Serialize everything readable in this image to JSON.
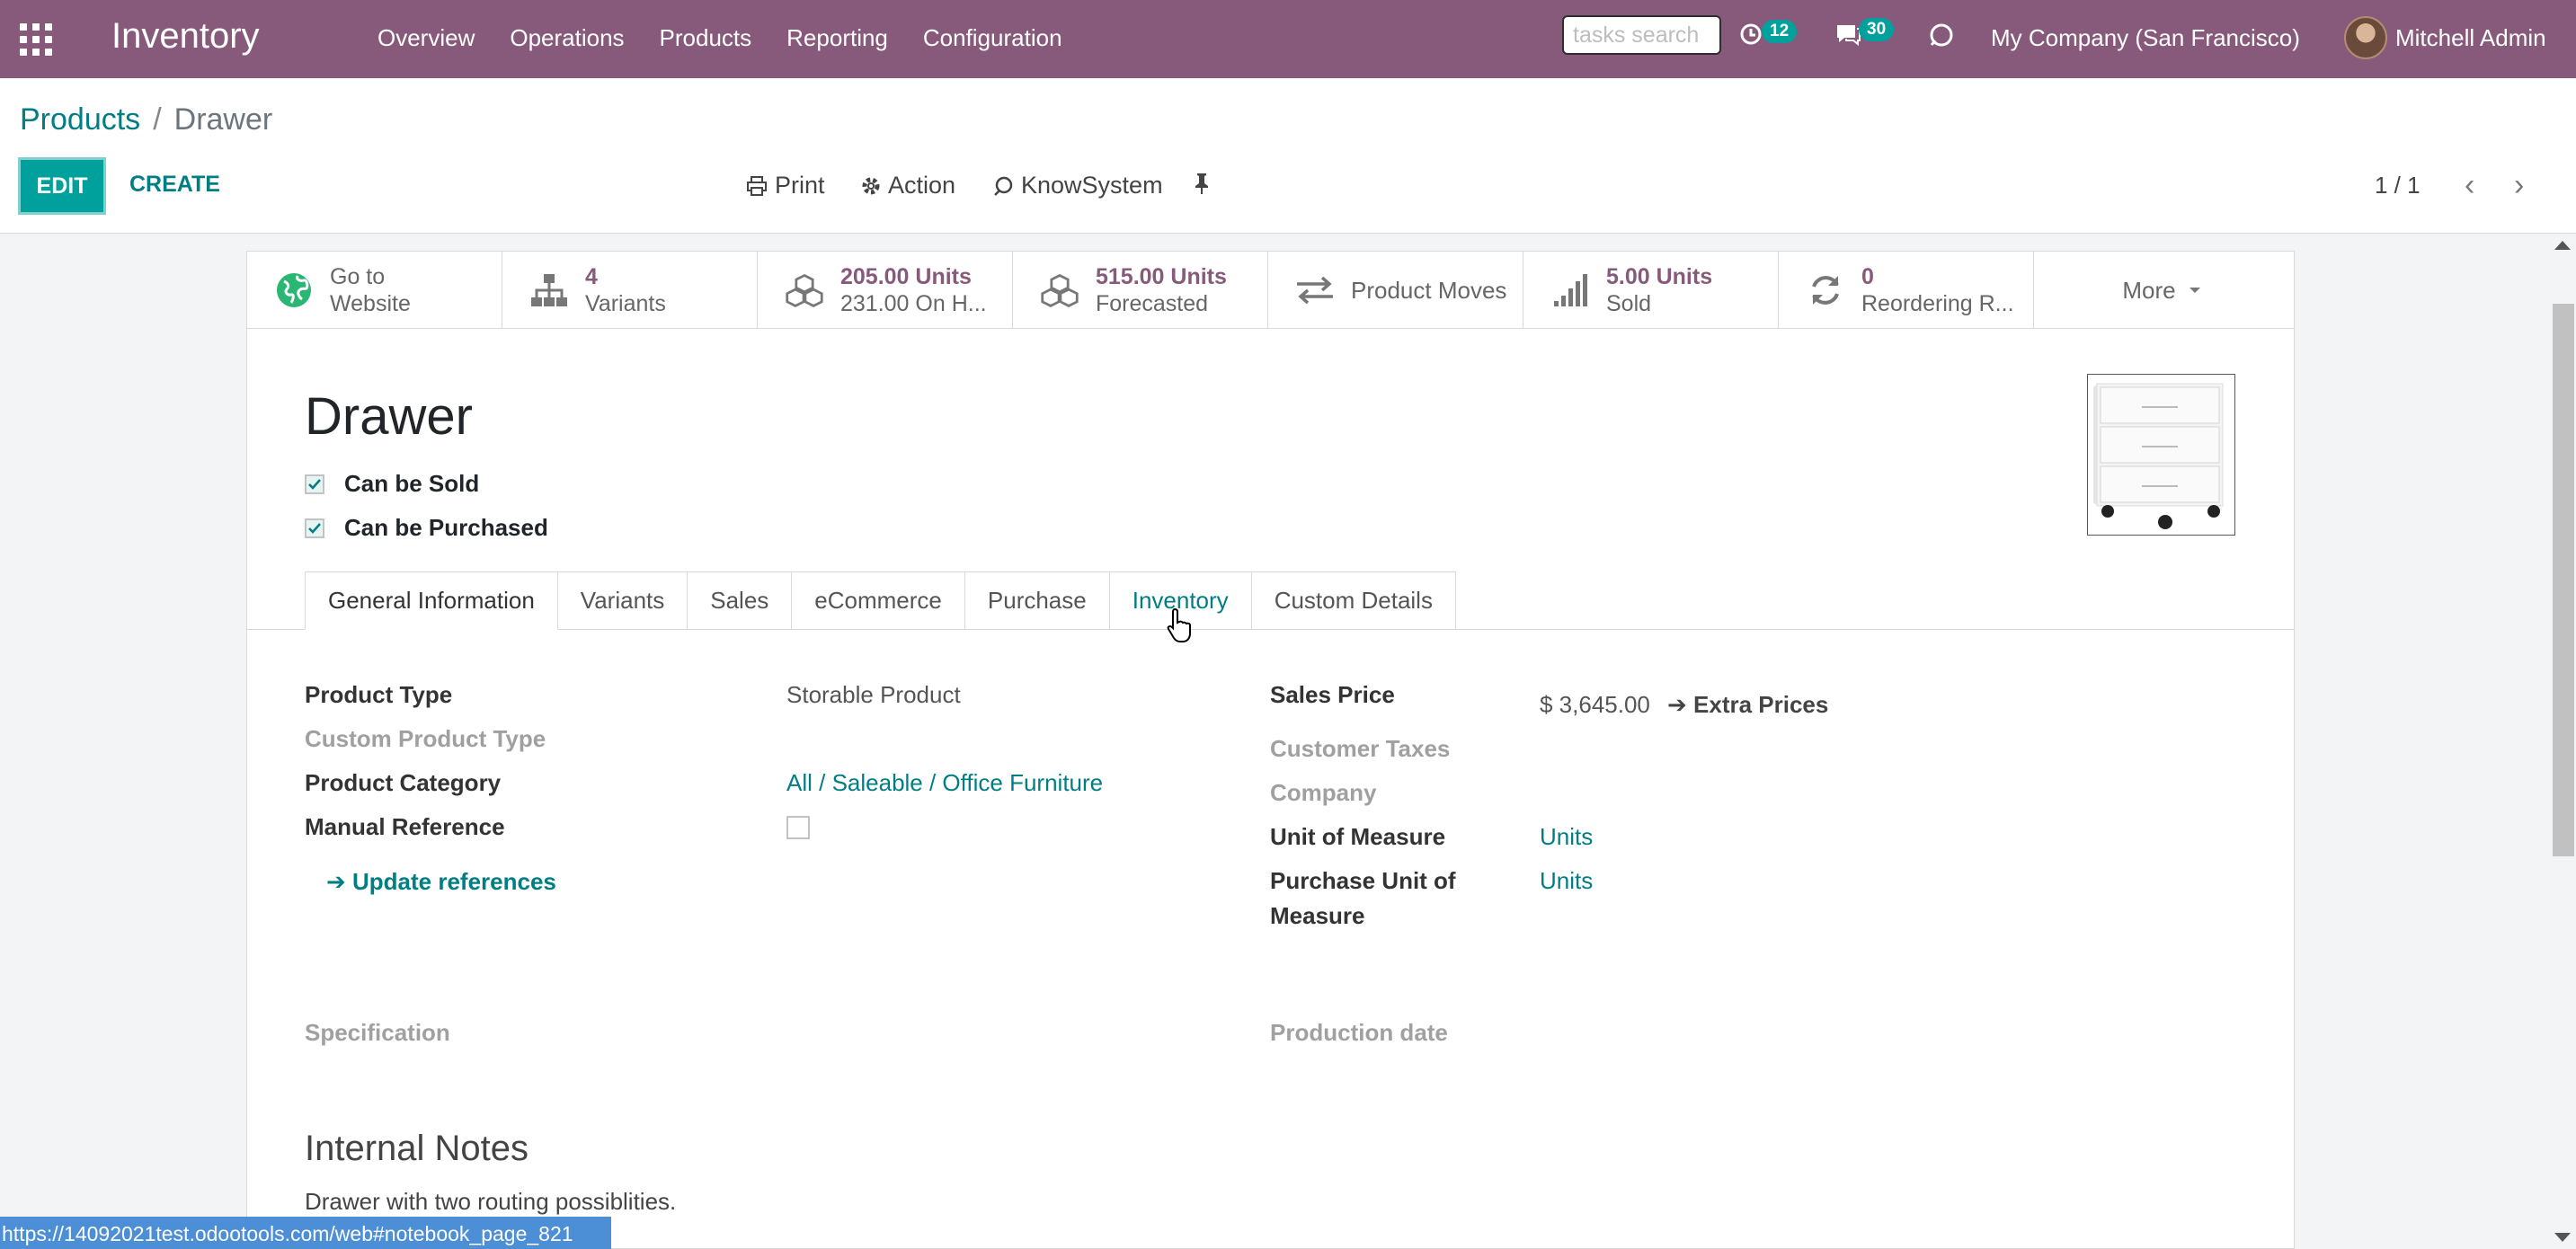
{
  "navbar": {
    "app_title": "Inventory",
    "menu": [
      "Overview",
      "Operations",
      "Products",
      "Reporting",
      "Configuration"
    ],
    "search_placeholder": "tasks search",
    "activity_count": "12",
    "messages_count": "30",
    "company": "My Company (San Francisco)",
    "user": "Mitchell Admin"
  },
  "breadcrumb": {
    "parent": "Products",
    "current": "Drawer"
  },
  "toolbar": {
    "edit": "EDIT",
    "create": "CREATE",
    "print": "Print",
    "action": "Action",
    "knowsystem": "KnowSystem",
    "pager": "1 / 1"
  },
  "smart_buttons": [
    {
      "icon": "globe-icon",
      "value": "Go to",
      "label": "Website"
    },
    {
      "icon": "sitemap-icon",
      "value": "4",
      "label": "Variants"
    },
    {
      "icon": "cubes-icon",
      "value": "205.00 Units",
      "label": "231.00 On H..."
    },
    {
      "icon": "cubes-icon",
      "value": "515.00 Units",
      "label": "Forecasted"
    },
    {
      "icon": "exchange-icon",
      "label": "Product Moves"
    },
    {
      "icon": "signal-icon",
      "value": "5.00 Units",
      "label": "Sold"
    },
    {
      "icon": "refresh-icon",
      "value": "0",
      "label": "Reordering R..."
    },
    {
      "label": "More"
    }
  ],
  "product": {
    "name": "Drawer",
    "can_be_sold": "Can be Sold",
    "can_be_purchased": "Can be Purchased"
  },
  "tabs": [
    "General Information",
    "Variants",
    "Sales",
    "eCommerce",
    "Purchase",
    "Inventory",
    "Custom Details"
  ],
  "general": {
    "product_type_label": "Product Type",
    "product_type_value": "Storable Product",
    "custom_product_type_label": "Custom Product Type",
    "product_category_label": "Product Category",
    "product_category_value": "All / Saleable / Office Furniture",
    "manual_reference_label": "Manual Reference",
    "update_references": "Update references",
    "sales_price_label": "Sales Price",
    "sales_price_value": "$ 3,645.00",
    "extra_prices": "Extra Prices",
    "customer_taxes_label": "Customer Taxes",
    "company_label": "Company",
    "uom_label": "Unit of Measure",
    "uom_value": "Units",
    "purchase_uom_label_1": "Purchase Unit of",
    "purchase_uom_label_2": "Measure",
    "purchase_uom_value": "Units",
    "specification_label": "Specification",
    "production_date_label": "Production date"
  },
  "notes": {
    "title": "Internal Notes",
    "text": "Drawer with two routing possiblities."
  },
  "status_url": "https://14092021test.odootools.com/web#notebook_page_821"
}
